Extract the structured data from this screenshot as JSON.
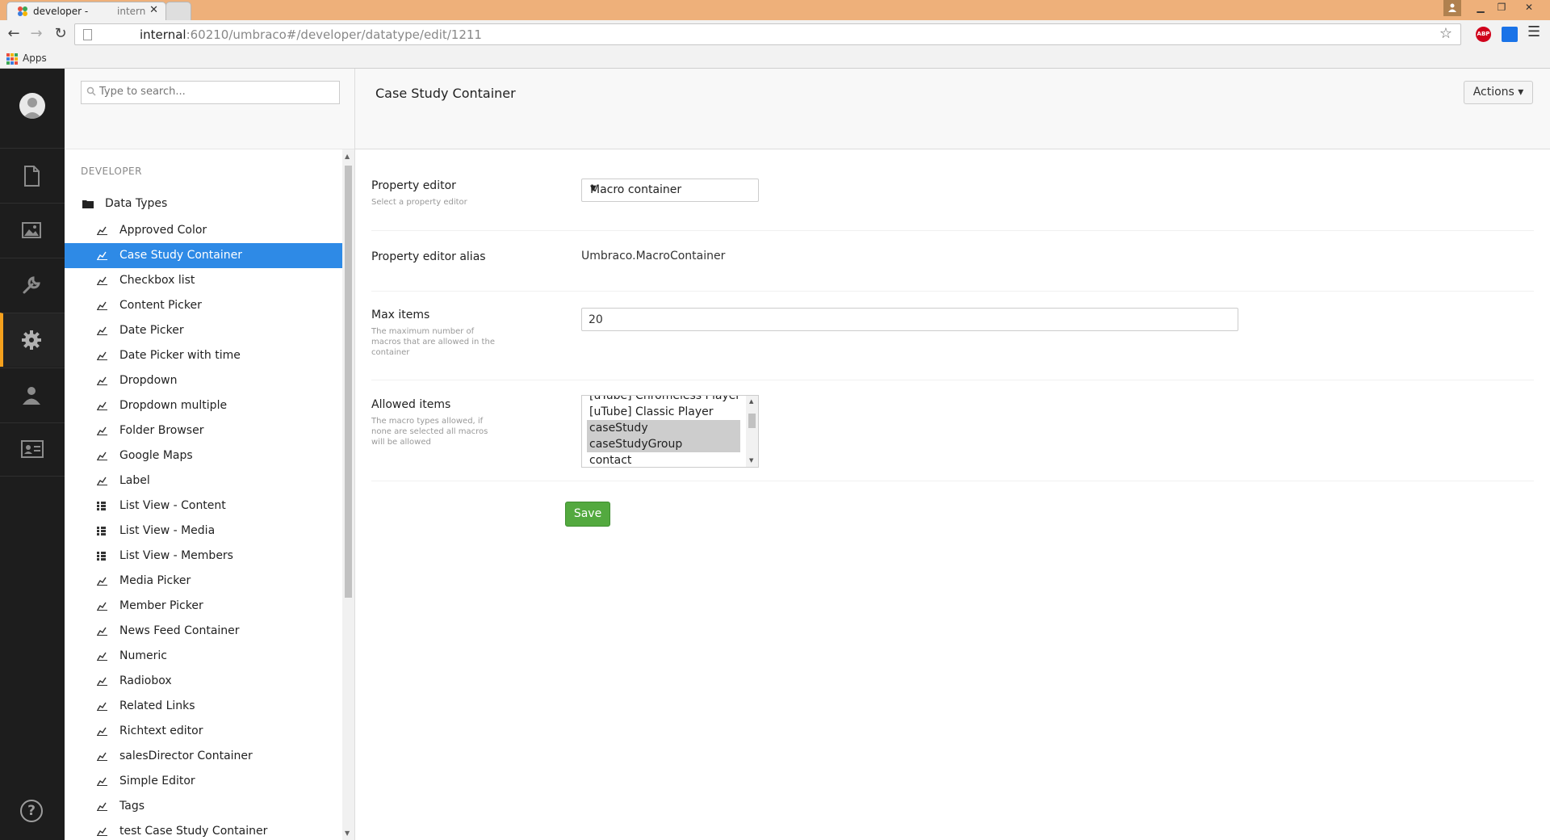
{
  "browser": {
    "tab_title": "developer -",
    "tab_title_secondary": "intern",
    "url_host": "internal",
    "url_path": ":60210/umbraco#/developer/datatype/edit/1211",
    "bookmarks_apps_label": "Apps"
  },
  "tree": {
    "search_placeholder": "Type to search...",
    "section_label": "DEVELOPER",
    "root_label": "Data Types",
    "items": [
      {
        "label": "Approved Color",
        "icon": "datatype-icon"
      },
      {
        "label": "Case Study Container",
        "icon": "datatype-icon",
        "selected": true
      },
      {
        "label": "Checkbox list",
        "icon": "datatype-icon"
      },
      {
        "label": "Content Picker",
        "icon": "datatype-icon"
      },
      {
        "label": "Date Picker",
        "icon": "datatype-icon"
      },
      {
        "label": "Date Picker with time",
        "icon": "datatype-icon"
      },
      {
        "label": "Dropdown",
        "icon": "datatype-icon"
      },
      {
        "label": "Dropdown multiple",
        "icon": "datatype-icon"
      },
      {
        "label": "Folder Browser",
        "icon": "datatype-icon"
      },
      {
        "label": "Google Maps",
        "icon": "datatype-icon"
      },
      {
        "label": "Label",
        "icon": "datatype-icon"
      },
      {
        "label": "List View - Content",
        "icon": "listview-icon"
      },
      {
        "label": "List View - Media",
        "icon": "listview-icon"
      },
      {
        "label": "List View - Members",
        "icon": "listview-icon"
      },
      {
        "label": "Media Picker",
        "icon": "datatype-icon"
      },
      {
        "label": "Member Picker",
        "icon": "datatype-icon"
      },
      {
        "label": "News Feed Container",
        "icon": "datatype-icon"
      },
      {
        "label": "Numeric",
        "icon": "datatype-icon"
      },
      {
        "label": "Radiobox",
        "icon": "datatype-icon"
      },
      {
        "label": "Related Links",
        "icon": "datatype-icon"
      },
      {
        "label": "Richtext editor",
        "icon": "datatype-icon"
      },
      {
        "label": "salesDirector Container",
        "icon": "datatype-icon"
      },
      {
        "label": "Simple Editor",
        "icon": "datatype-icon"
      },
      {
        "label": "Tags",
        "icon": "datatype-icon"
      },
      {
        "label": "test Case Study Container",
        "icon": "datatype-icon"
      }
    ]
  },
  "editor": {
    "title": "Case Study Container",
    "actions_label": "Actions ▾",
    "property_editor": {
      "label": "Property editor",
      "description": "Select a property editor",
      "selected_value": "Macro container"
    },
    "property_editor_alias": {
      "label": "Property editor alias",
      "value": "Umbraco.MacroContainer"
    },
    "max_items": {
      "label": "Max items",
      "description": "The maximum number of macros that are allowed in the container",
      "value": "20"
    },
    "allowed_items": {
      "label": "Allowed items",
      "description": "The macro types allowed, if none are selected all macros will be allowed",
      "options": [
        {
          "label": "[uTube] Chromeless Player M",
          "selected": false
        },
        {
          "label": "[uTube] Classic Player",
          "selected": false
        },
        {
          "label": "caseStudy",
          "selected": true
        },
        {
          "label": "caseStudyGroup",
          "selected": true
        },
        {
          "label": "contact",
          "selected": false
        }
      ]
    },
    "save_label": "Save"
  },
  "colors": {
    "accent_orange": "#f5a11d",
    "selection_blue": "#2e8ae6",
    "save_green": "#53a93f",
    "appbar_dark": "#1d1d1d"
  }
}
